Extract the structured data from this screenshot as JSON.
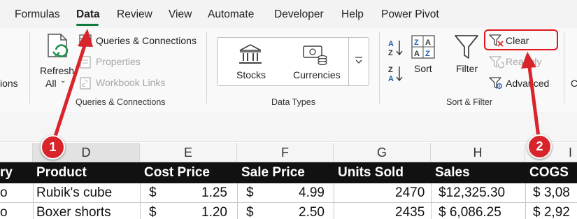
{
  "tabs": [
    {
      "label": "Formulas",
      "active": false
    },
    {
      "label": "Data",
      "active": true
    },
    {
      "label": "Review",
      "active": false
    },
    {
      "label": "View",
      "active": false
    },
    {
      "label": "Automate",
      "active": false
    },
    {
      "label": "Developer",
      "active": false
    },
    {
      "label": "Help",
      "active": false
    },
    {
      "label": "Power Pivot",
      "active": false
    }
  ],
  "ribbon": {
    "partial_left_label": "ions",
    "refresh_all": {
      "line1": "Refresh",
      "line2": "All"
    },
    "queries_connections": "Queries & Connections",
    "properties": "Properties",
    "workbook_links": "Workbook Links",
    "group_queries": "Queries & Connections",
    "stocks": "Stocks",
    "currencies": "Currencies",
    "group_data_types": "Data Types",
    "sort_az": "A→Z",
    "sort_za": "Z→A",
    "sort": "Sort",
    "filter": "Filter",
    "clear": "Clear",
    "reapply": "Reapply",
    "advanced": "Advanced",
    "group_sort_filter": "Sort & Filter",
    "partial_right_label": "C"
  },
  "columns": [
    "D",
    "E",
    "F",
    "G",
    "H",
    "I"
  ],
  "table": {
    "headers": [
      "ry",
      "Product",
      "Cost Price",
      "Sale Price",
      "Units Sold",
      "Sales",
      "COGS"
    ],
    "rows": [
      {
        "a": "o",
        "product": "Rubik's cube",
        "cost_sym": "$",
        "cost": "1.25",
        "sale_sym": "$",
        "sale": "4.99",
        "units": "2470",
        "sales": "$12,325.30",
        "cogs": "$ 3,08"
      },
      {
        "a": "o",
        "product": "Boxer shorts",
        "cost_sym": "$",
        "cost": "1.20",
        "sale_sym": "$",
        "sale": "2.50",
        "units": "2435",
        "sales": "$ 6,086.25",
        "cogs": "$ 2,92"
      }
    ]
  },
  "callouts": [
    "1",
    "2"
  ],
  "colors": {
    "accent": "#0f7b3e",
    "callout": "#d8252b",
    "highlight_box": "#e0151d"
  }
}
